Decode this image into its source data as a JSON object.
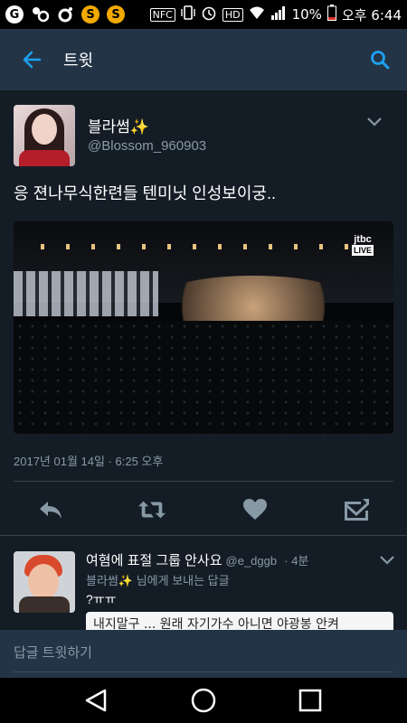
{
  "status_bar": {
    "battery": "10%",
    "time": "오후 6:44",
    "nfc_label": "NFC",
    "hd_label": "HD"
  },
  "app_bar": {
    "title": "트윗",
    "accent_color": "#1da1f2"
  },
  "tweet": {
    "display_name": "블라썸",
    "sparkle": "✨",
    "handle": "@Blossom_960903",
    "text": "응 젼나무식한련들 텐미닛 인성보이궁..",
    "media_logo": "jtbc",
    "media_live": "LIVE",
    "timestamp": "2017년 01월 14일 · 6:25 오후"
  },
  "reply": {
    "display_name": "여혐에 표절 그룹 안사요",
    "handle": "@e_dggb",
    "age": "· 4분",
    "replying_to_name": "블라썸",
    "replying_to_sparkle": "✨",
    "replying_to_suffix": "님에게 보내는 답글",
    "text": "?ㅠㅠ",
    "card_text": "내지말구 ... 원래 자기가수 아니면 야광봉 안켜"
  },
  "compose": {
    "placeholder": "답글 트윗하기"
  },
  "icons": {
    "back": "arrow-left-icon",
    "search": "search-icon",
    "reply": "reply-icon",
    "retweet": "retweet-icon",
    "like": "heart-icon",
    "dm": "envelope-icon"
  }
}
